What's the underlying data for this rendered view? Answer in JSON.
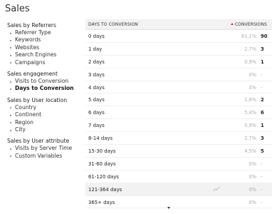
{
  "page_title": "Sales",
  "sidebar": {
    "groups": [
      {
        "title": "Sales by Referrers",
        "items": [
          "Referrer Type",
          "Keywords",
          "Websites",
          "Search Engines",
          "Campaigns"
        ]
      },
      {
        "title": "Sales engagement",
        "items": [
          "Visits to Conversion",
          "Days to Conversion"
        ],
        "active": "Days to Conversion"
      },
      {
        "title": "Sales by User location",
        "items": [
          "Country",
          "Continent",
          "Region",
          "City"
        ]
      },
      {
        "title": "Sales by User attribute",
        "items": [
          "Visits by Server Time",
          "Custom Variables"
        ]
      }
    ]
  },
  "table": {
    "column_label": "DAYS TO CONVERSION",
    "column_conversions": "CONVERSIONS",
    "rows": [
      {
        "label": "0 days",
        "pct": "81,1%",
        "value": "90"
      },
      {
        "label": "1 day",
        "pct": "2,7%",
        "value": "3"
      },
      {
        "label": "2 days",
        "pct": "0,9%",
        "value": "1"
      },
      {
        "label": "3 days",
        "pct": "0%",
        "value": "-"
      },
      {
        "label": "4 days",
        "pct": "0%",
        "value": "-"
      },
      {
        "label": "5 days",
        "pct": "1,8%",
        "value": "2"
      },
      {
        "label": "6 days",
        "pct": "5,4%",
        "value": "6"
      },
      {
        "label": "7 days",
        "pct": "0,9%",
        "value": "1"
      },
      {
        "label": "8-14 days",
        "pct": "2,7%",
        "value": "3"
      },
      {
        "label": "15-30 days",
        "pct": "4,5%",
        "value": "5"
      },
      {
        "label": "31-60 days",
        "pct": "0%",
        "value": "-"
      },
      {
        "label": "61-120 days",
        "pct": "0%",
        "value": "-"
      },
      {
        "label": "121-364 days",
        "pct": "0%",
        "value": "-"
      },
      {
        "label": "365+ days",
        "pct": "0%",
        "value": "-"
      }
    ],
    "hover_row": "121-364 days",
    "row_action_icon": "row-evolution-icon"
  }
}
